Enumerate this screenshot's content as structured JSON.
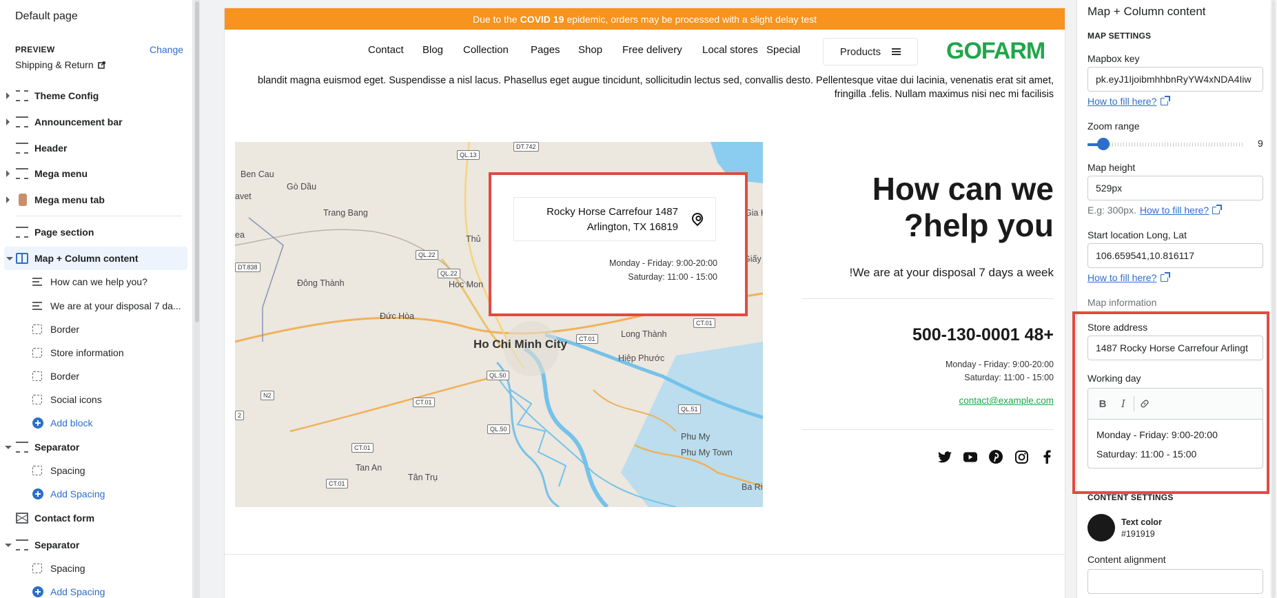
{
  "sidebar": {
    "title": "Default page",
    "preview_label": "PREVIEW",
    "preview_change": "Change",
    "preview_value": "Shipping & Return",
    "items": [
      {
        "label": "Theme Config"
      },
      {
        "label": "Announcement bar"
      },
      {
        "label": "Header"
      },
      {
        "label": "Mega menu"
      },
      {
        "label": "Mega menu tab"
      },
      {
        "label": "Page section"
      },
      {
        "label": "Map + Column content"
      },
      {
        "label": "How can we help you?"
      },
      {
        "label": "We are at your disposal 7 da..."
      },
      {
        "label": "Border"
      },
      {
        "label": "Store information"
      },
      {
        "label": "Border"
      },
      {
        "label": "Social icons"
      },
      {
        "label": "Add block"
      },
      {
        "label": "Separator"
      },
      {
        "label": "Spacing"
      },
      {
        "label": "Add Spacing"
      },
      {
        "label": "Contact form"
      },
      {
        "label": "Separator"
      },
      {
        "label": "Spacing"
      },
      {
        "label": "Add Spacing"
      }
    ]
  },
  "store": {
    "announcement_pre": "Due to the",
    "announcement_bold": "COVID 19",
    "announcement_post": "epidemic, orders may be processed with a slight delay test",
    "nav": [
      "Contact",
      "Blog",
      "Collection",
      "Pages",
      "Shop",
      "Free delivery",
      "Local stores",
      "Special"
    ],
    "products_label": "Products",
    "logo": "GOFARM",
    "paragraph": "blandit magna euismod eget. Suspendisse a nisl lacus. Phasellus eget augue tincidunt, sollicitudin lectus sed, convallis desto. Pellentesque vitae dui lacinia, venenatis erat sit amet, fringilla .felis. Nullam maximus nisi nec mi facilisis",
    "map": {
      "labels": [
        "Ben Cau",
        "Gò Dầu",
        "avet",
        "Trang Bang",
        "Thủ",
        "ea",
        "Đông Thành",
        "Hoc Mon",
        "Đức Hòa",
        "Long Thành",
        "Hiệp Phước",
        "Tan An",
        "Tân Trụ",
        "Phu My",
        "Phu My Town",
        "Ba Ri",
        "Gia Ki",
        "Giấy"
      ],
      "city": "Ho Chi Minh City",
      "shields": [
        "QL.13",
        "QL.22",
        "QL.22",
        "DT.838",
        "DT.742",
        "CT.01",
        "CT.01",
        "QL.50",
        "CT.01",
        "N2",
        "QL.50",
        "CT.01",
        "CT.01",
        "QL.51",
        "CT.01",
        "2"
      ],
      "popup_address_line1": "Rocky Horse Carrefour 1487",
      "popup_address_line2": "Arlington, TX 16819",
      "popup_hours_line1": "Monday - Friday: 9:00-20:00",
      "popup_hours_line2": "Saturday: 11:00 - 15:00"
    },
    "heading_line1": "How can we",
    "heading_line2": "?help you",
    "subheading": "!We are at your disposal 7 days a week",
    "phone": "500-130-0001 48+",
    "hours_line1": "Monday - Friday: 9:00-20:00",
    "hours_line2": "Saturday: 11:00 - 15:00",
    "email": "contact@example.com",
    "social_icons": [
      "twitter-icon",
      "youtube-icon",
      "pinterest-icon",
      "instagram-icon",
      "facebook-icon"
    ]
  },
  "settings": {
    "title": "Map + Column content",
    "map_settings_label": "MAP SETTINGS",
    "mapbox_key_label": "Mapbox key",
    "mapbox_key_value": "pk.eyJ1IjoibmhhbnRyYW4xNDA4Iiw",
    "how_to_fill": "How to fill here?",
    "zoom_label": "Zoom range",
    "zoom_value": "9",
    "zoom_fraction": 0.06,
    "map_height_label": "Map height",
    "map_height_value": "529px",
    "map_height_hint": "E.g: 300px.",
    "start_location_label": "Start location Long, Lat",
    "start_location_value": "106.659541,10.816117",
    "map_information_label": "Map information",
    "store_address_label": "Store address",
    "store_address_value": "1487 Rocky Horse Carrefour Arlingt",
    "working_day_label": "Working day",
    "working_day_line1": "Monday - Friday: 9:00-20:00",
    "working_day_line2": "Saturday: 11:00 - 15:00",
    "content_settings_label": "CONTENT SETTINGS",
    "text_color_label": "Text color",
    "text_color_value": "#191919",
    "content_alignment_label": "Content alignment"
  },
  "colors": {
    "announcement_bg": "#f7931e",
    "accent_blue": "#2c6ecb",
    "highlight_red": "#e04b42",
    "brand_green": "#1fa64a"
  }
}
